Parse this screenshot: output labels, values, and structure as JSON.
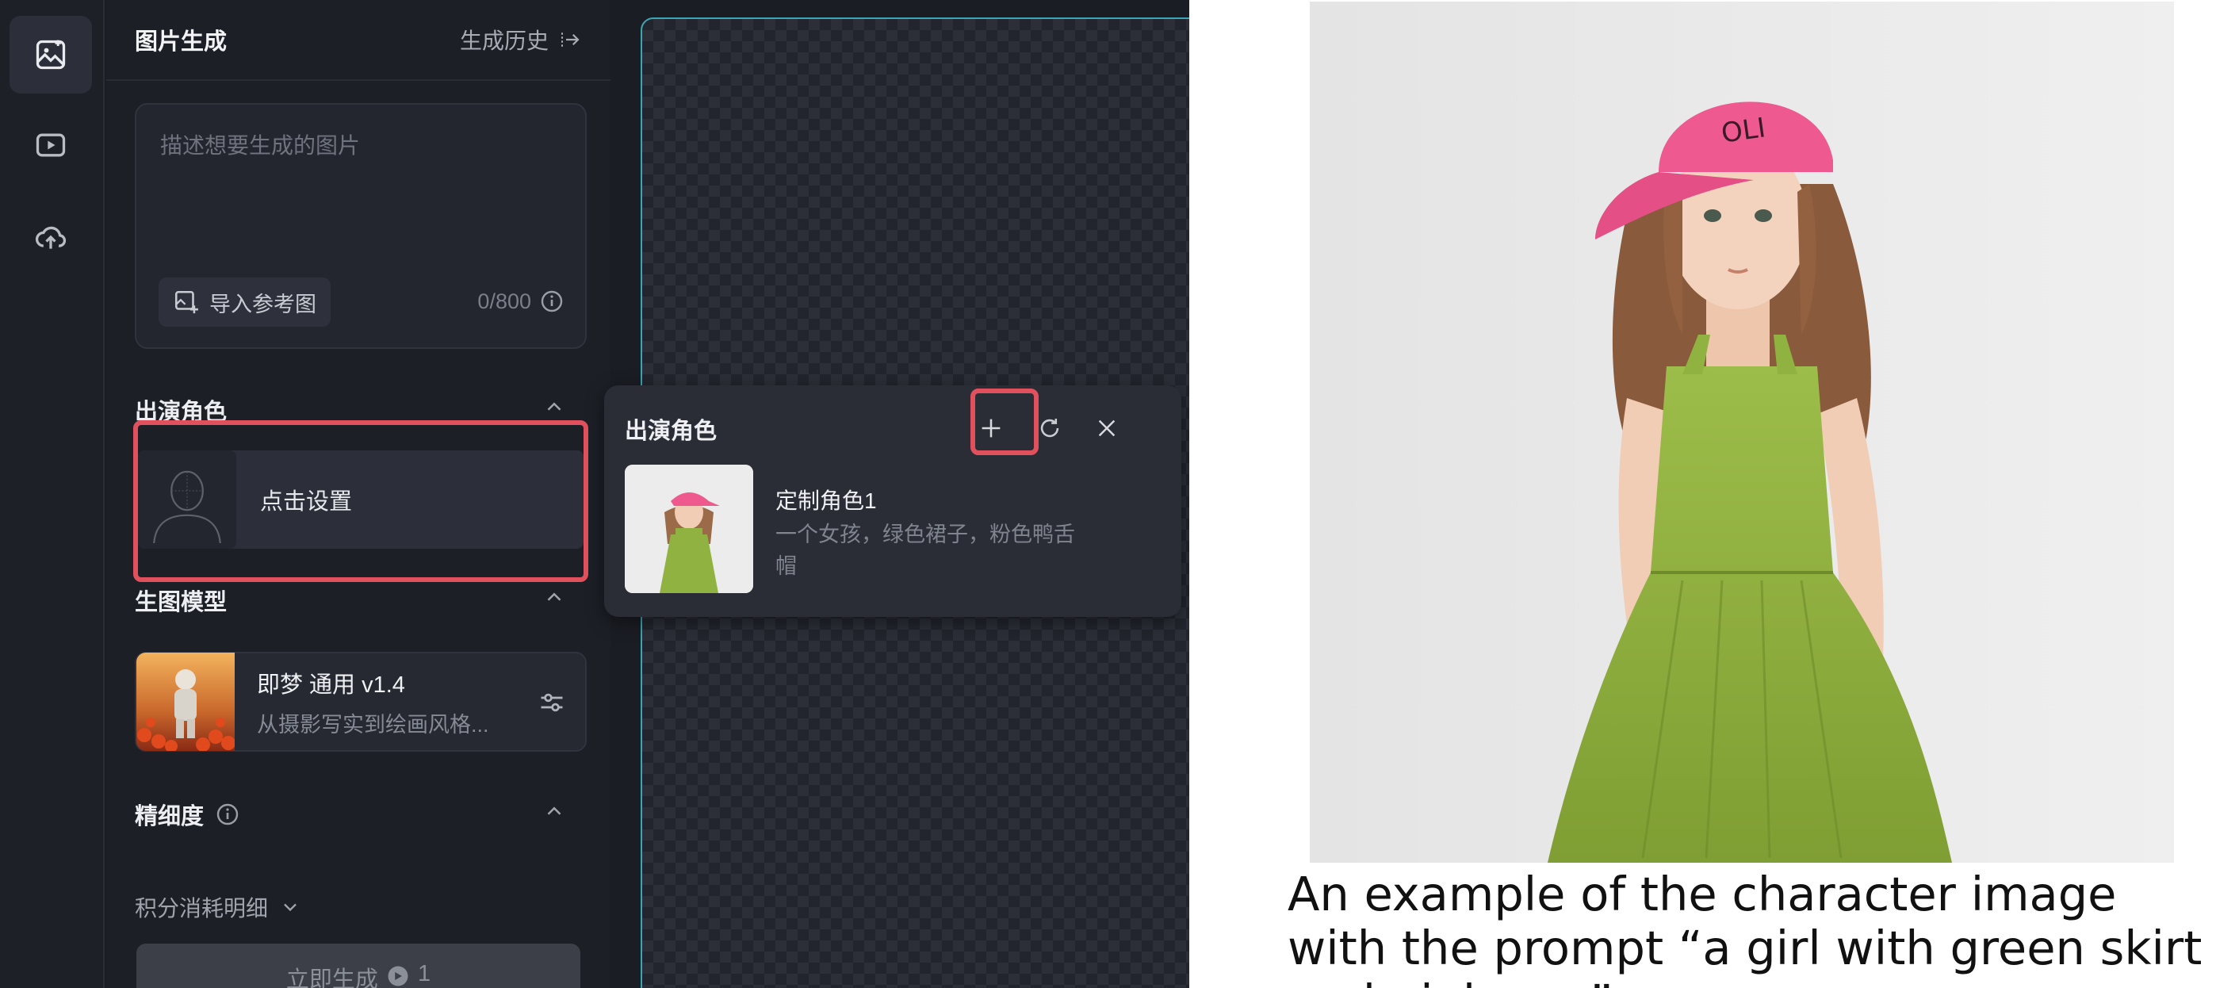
{
  "panel": {
    "title": "图片生成",
    "history_label": "生成历史"
  },
  "prompt": {
    "placeholder": "描述想要生成的图片",
    "import_ref_label": "导入参考图",
    "counter": "0/800"
  },
  "roles_section": {
    "title": "出演角色",
    "set_label": "点击设置"
  },
  "model_section": {
    "title": "生图模型",
    "model_name": "即梦 通用 v1.4",
    "model_desc": "从摄影写实到绘画风格..."
  },
  "precision": {
    "title": "精细度"
  },
  "credits": {
    "label": "积分消耗明细"
  },
  "generate": {
    "label": "立即生成",
    "cost": "1"
  },
  "popover": {
    "title": "出演角色",
    "item_name": "定制角色1",
    "item_desc": "一个女孩，绿色裙子，粉色鸭舌帽"
  },
  "example": {
    "cap_text": "OLI",
    "caption": "An example of the character image with the prompt “a girl with green skirt and pink cap”"
  },
  "colors": {
    "highlight": "#e0515d",
    "canvas_border": "#3aa7b5",
    "panel_bg": "#1d1f27"
  },
  "icons": [
    "image-gen-icon",
    "video-gen-icon",
    "cloud-upload-icon",
    "history-arrow-icon",
    "import-image-icon",
    "info-icon",
    "chevron-up-icon",
    "settings-sliders-icon",
    "plus-icon",
    "refresh-icon",
    "close-icon",
    "chevron-down-icon"
  ]
}
